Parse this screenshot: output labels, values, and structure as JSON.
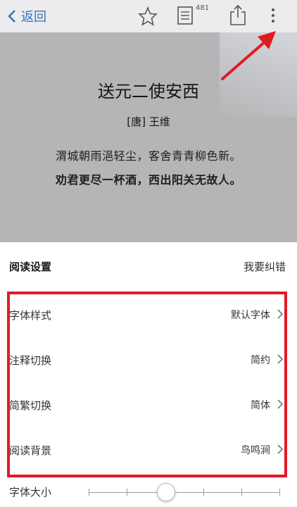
{
  "topbar": {
    "back_label": "返回",
    "notes_badge": "481",
    "icons": [
      "star-icon",
      "notes-icon",
      "share-icon",
      "more-icon"
    ]
  },
  "poem": {
    "title": "送元二使安西",
    "author": "[唐] 王维",
    "line1": "渭城朝雨浥轻尘，客舍青青柳色新。",
    "line2": "劝君更尽一杯酒，西出阳关无故人。"
  },
  "settings": {
    "title": "阅读设置",
    "report_label": "我要纠错",
    "rows": [
      {
        "label": "字体样式",
        "value": "默认字体"
      },
      {
        "label": "注释切换",
        "value": "简约"
      },
      {
        "label": "简繁切换",
        "value": "简体"
      },
      {
        "label": "阅读背景",
        "value": "鸟鸣涧"
      }
    ],
    "font_size_label": "字体大小",
    "font_size_level": 0.4
  },
  "colors": {
    "accent": "#3b6fb8",
    "highlight": "#e21a22"
  }
}
